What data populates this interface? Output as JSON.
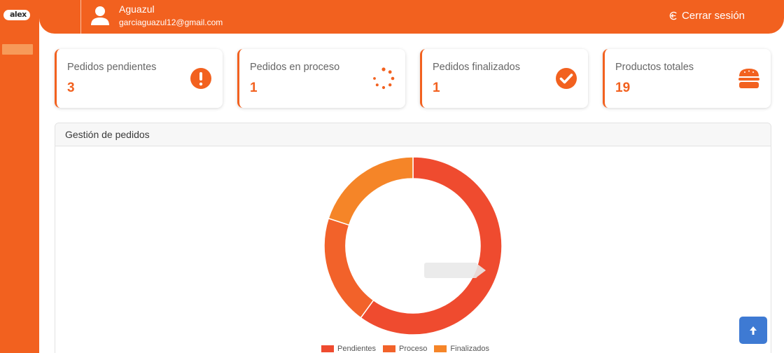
{
  "sidebar": {
    "brand": "alex",
    "brand_color": "#f2611f"
  },
  "header": {
    "user_name": "Aguazul",
    "user_email": "garciaguazul12@gmail.com",
    "logout_label": "Cerrar sesión",
    "logout_icon": "logout-icon"
  },
  "cards": [
    {
      "label": "Pedidos pendientes",
      "value": "3",
      "icon": "exclamation-circle-icon"
    },
    {
      "label": "Pedidos en proceso",
      "value": "1",
      "icon": "spinner-icon"
    },
    {
      "label": "Pedidos finalizados",
      "value": "1",
      "icon": "check-circle-icon"
    },
    {
      "label": "Productos totales",
      "value": "19",
      "icon": "hamburger-icon"
    }
  ],
  "panel": {
    "title": "Gestión de pedidos"
  },
  "chart_data": {
    "type": "doughnut",
    "categories": [
      "Pendientes",
      "Proceso",
      "Finalizados"
    ],
    "values": [
      3,
      1,
      1
    ],
    "colors": [
      "#ef4b2f",
      "#f2622a",
      "#f58528"
    ],
    "legend": "bottom"
  },
  "scroll_top_icon": "arrow-up-icon"
}
